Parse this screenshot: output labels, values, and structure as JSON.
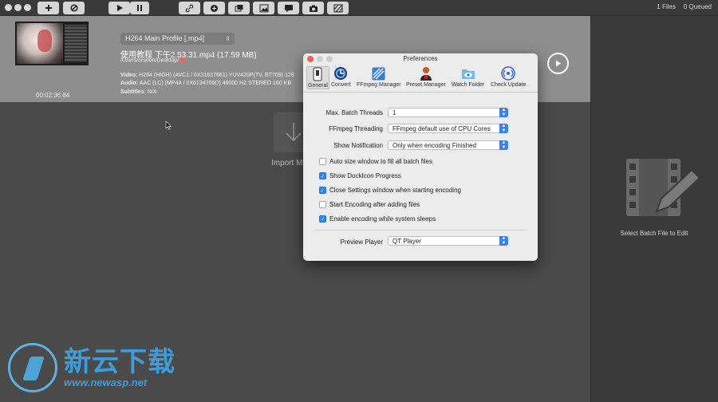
{
  "toolbar": {
    "counters": {
      "files": "1 Files",
      "queued": "0 Queued"
    }
  },
  "file": {
    "profile": "H264 Main Profile [.mp4]",
    "name": "使用教程 下午2.53.31.mp4  (17.59 MB)",
    "path": "/Users/orsoon/Desktop/",
    "duration": "00:02:36.84",
    "video_label": "Video:",
    "video_value": "H264 (HIGH) (AVC1 / 0X31637661)   YUV420P(TV, BT709)   128",
    "audio_label": "Audio:",
    "audio_value": "AAC (LC) (MP4A / 0X6134706D)   48000 HZ   STEREO   160 KB",
    "subtitles_label": "Subtitles:",
    "subtitles_value": "N/A"
  },
  "import": {
    "label": "Import Me"
  },
  "batch": {
    "label": "Select Batch File to Edit"
  },
  "preferences": {
    "title": "Preferences",
    "tabs": [
      {
        "label": "General"
      },
      {
        "label": "Convert"
      },
      {
        "label": "FFmpeg Manager"
      },
      {
        "label": "Preset Manager"
      },
      {
        "label": "Watch Folder"
      },
      {
        "label": "Check Update"
      }
    ],
    "max_batch_threads": {
      "label": "Max. Batch Threads",
      "value": "1"
    },
    "ffmpeg_threading": {
      "label": "FFmpeg Threading",
      "value": "FFmpeg default use of CPU Cores"
    },
    "show_notification": {
      "label": "Show Notification",
      "value": "Only when encoding Finished"
    },
    "checkboxes": [
      {
        "label": "Auto size window to fill all batch files",
        "checked": false
      },
      {
        "label": "Show DockIcon Progress",
        "checked": true
      },
      {
        "label": "Close Settings window when starting encoding",
        "checked": true
      },
      {
        "label": "Start Encoding after adding files",
        "checked": false
      },
      {
        "label": "Enable encoding while system sleeps",
        "checked": true
      }
    ],
    "preview_player": {
      "label": "Preview Player",
      "value": "QT Player"
    }
  },
  "watermark": {
    "cn": "新云下载",
    "url": "www.newasp.net"
  },
  "colors": {
    "accent": "#3b82e6",
    "close": "#fc605b",
    "panel": "#ececec"
  }
}
